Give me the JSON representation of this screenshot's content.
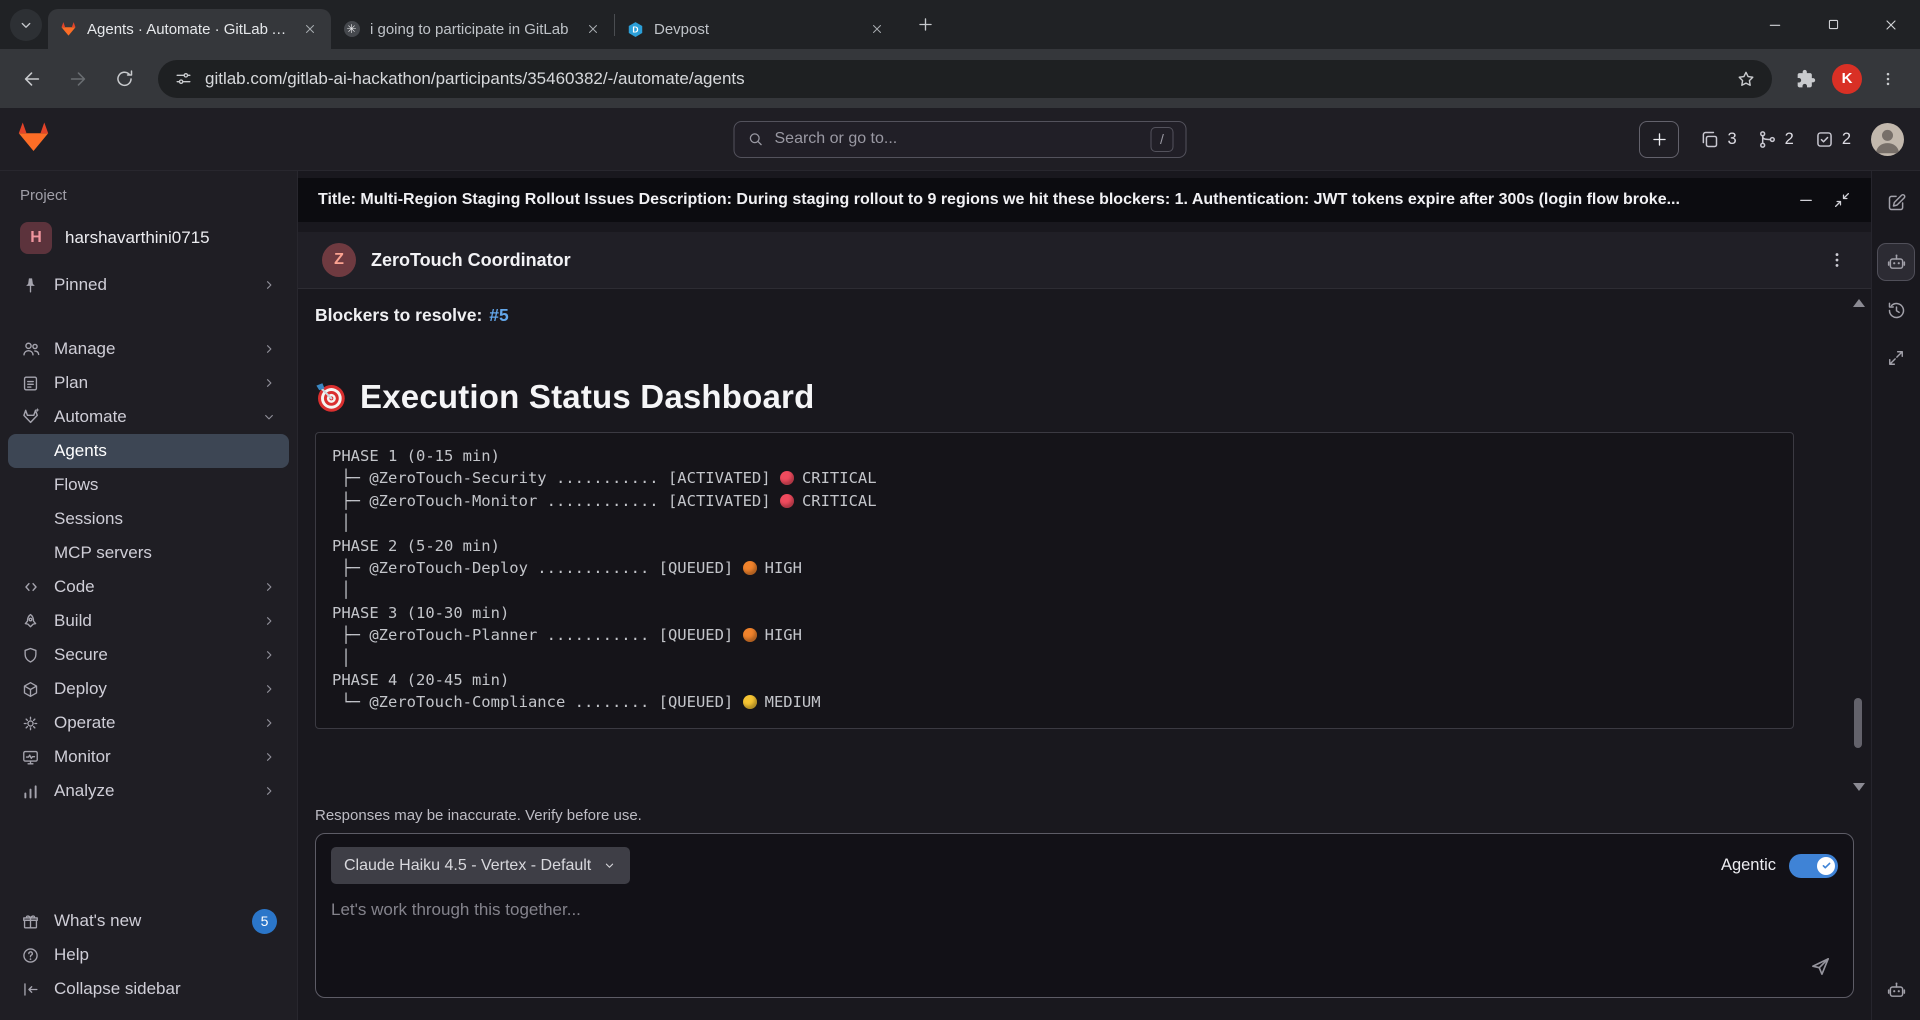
{
  "browser": {
    "tabs": [
      {
        "title": "Agents · Automate · GitLab AI H"
      },
      {
        "title": "i going to participate in GitLab"
      },
      {
        "title": "Devpost"
      }
    ],
    "url": "gitlab.com/gitlab-ai-hackathon/participants/35460382/-/automate/agents",
    "profile_initial": "K"
  },
  "topbar": {
    "search_placeholder": "Search or go to...",
    "search_shortcut": "/",
    "issues_count": "3",
    "merge_requests_count": "2",
    "todos_count": "2"
  },
  "sidebar": {
    "section_label": "Project",
    "project_initial": "H",
    "project_name": "harshavarthini0715",
    "pinned_label": "Pinned",
    "items": [
      {
        "label": "Manage"
      },
      {
        "label": "Plan"
      },
      {
        "label": "Automate"
      },
      {
        "label": "Code"
      },
      {
        "label": "Build"
      },
      {
        "label": "Secure"
      },
      {
        "label": "Deploy"
      },
      {
        "label": "Operate"
      },
      {
        "label": "Monitor"
      },
      {
        "label": "Analyze"
      }
    ],
    "automate_children": [
      {
        "label": "Agents"
      },
      {
        "label": "Flows"
      },
      {
        "label": "Sessions"
      },
      {
        "label": "MCP servers"
      }
    ],
    "whats_new_label": "What's new",
    "whats_new_badge": "5",
    "help_label": "Help",
    "collapse_label": "Collapse sidebar"
  },
  "chat": {
    "context_banner": "Title: Multi-Region Staging Rollout Issues Description: During staging rollout to 9 regions we hit these blockers: 1. Authentication: JWT tokens expire after 300s (login flow broke...",
    "agent_initial": "Z",
    "agent_name": "ZeroTouch Coordinator",
    "blockers_label": "Blockers to resolve:",
    "blockers_link": "#5",
    "dashboard_heading": "Execution Status Dashboard",
    "code_lines": [
      {
        "text": "PHASE 1 (0-15 min)"
      },
      {
        "text": " ├─ @ZeroTouch-Security ........... [ACTIVATED] ",
        "dot": "#ef4b5e",
        "level": "CRITICAL"
      },
      {
        "text": " ├─ @ZeroTouch-Monitor ............ [ACTIVATED] ",
        "dot": "#ef4b5e",
        "level": "CRITICAL"
      },
      {
        "text": " │"
      },
      {
        "text": "PHASE 2 (5-20 min)"
      },
      {
        "text": " ├─ @ZeroTouch-Deploy ............ [QUEUED] ",
        "dot": "#f0832c",
        "level": "HIGH"
      },
      {
        "text": " │"
      },
      {
        "text": "PHASE 3 (10-30 min)"
      },
      {
        "text": " ├─ @ZeroTouch-Planner ........... [QUEUED] ",
        "dot": "#f0832c",
        "level": "HIGH"
      },
      {
        "text": " │"
      },
      {
        "text": "PHASE 4 (20-45 min)"
      },
      {
        "text": " └─ @ZeroTouch-Compliance ........ [QUEUED] ",
        "dot": "#f5c433",
        "level": "MEDIUM"
      }
    ],
    "disclaimer": "Responses may be inaccurate. Verify before use.",
    "model_selector": "Claude Haiku 4.5 - Vertex - Default",
    "agentic_label": "Agentic",
    "input_placeholder": "Let's work through this together..."
  },
  "colors": {
    "link_blue": "#63a6e9",
    "toggle_on": "#3f83d6",
    "badge_blue": "#2b76c9",
    "critical": "#ef4b5e",
    "high": "#f0832c",
    "medium": "#f5c433",
    "tanuki_orange": "#fc6d26",
    "tanuki_red": "#e24329"
  }
}
